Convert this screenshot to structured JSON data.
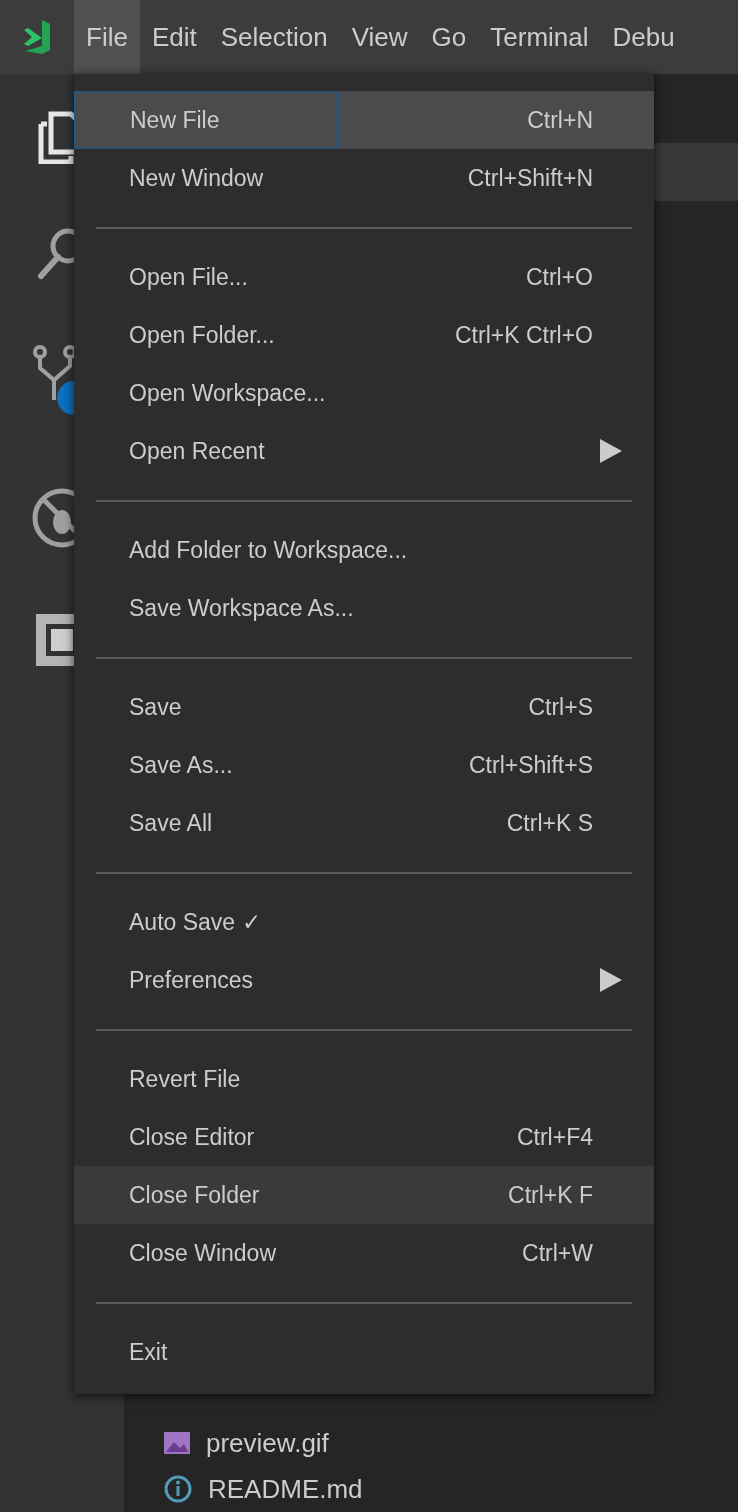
{
  "menu_bar": {
    "items": [
      {
        "label": "File",
        "selected": true
      },
      {
        "label": "Edit",
        "selected": false
      },
      {
        "label": "Selection",
        "selected": false
      },
      {
        "label": "View",
        "selected": false
      },
      {
        "label": "Go",
        "selected": false
      },
      {
        "label": "Terminal",
        "selected": false
      },
      {
        "label": "Debu",
        "selected": false
      }
    ]
  },
  "file_menu": {
    "sections": [
      [
        {
          "label": "New File",
          "shortcut": "Ctrl+N",
          "selected": true,
          "hovered": false,
          "submenu": false
        },
        {
          "label": "New Window",
          "shortcut": "Ctrl+Shift+N",
          "selected": false,
          "hovered": false,
          "submenu": false
        }
      ],
      [
        {
          "label": "Open File...",
          "shortcut": "Ctrl+O",
          "selected": false,
          "hovered": false,
          "submenu": false
        },
        {
          "label": "Open Folder...",
          "shortcut": "Ctrl+K Ctrl+O",
          "selected": false,
          "hovered": false,
          "submenu": false
        },
        {
          "label": "Open Workspace...",
          "selected": false,
          "hovered": false,
          "submenu": false
        },
        {
          "label": "Open Recent",
          "selected": false,
          "hovered": false,
          "submenu": true
        }
      ],
      [
        {
          "label": "Add Folder to Workspace...",
          "selected": false,
          "hovered": false,
          "submenu": false
        },
        {
          "label": "Save Workspace As...",
          "selected": false,
          "hovered": false,
          "submenu": false
        }
      ],
      [
        {
          "label": "Save",
          "shortcut": "Ctrl+S",
          "selected": false,
          "hovered": false,
          "submenu": false
        },
        {
          "label": "Save As...",
          "shortcut": "Ctrl+Shift+S",
          "selected": false,
          "hovered": false,
          "submenu": false
        },
        {
          "label": "Save All",
          "shortcut": "Ctrl+K S",
          "selected": false,
          "hovered": false,
          "submenu": false
        }
      ],
      [
        {
          "label": "Auto Save ✓",
          "selected": false,
          "hovered": false,
          "submenu": false
        },
        {
          "label": "Preferences",
          "selected": false,
          "hovered": false,
          "submenu": true
        }
      ],
      [
        {
          "label": "Revert File",
          "selected": false,
          "hovered": false,
          "submenu": false
        },
        {
          "label": "Close Editor",
          "shortcut": "Ctrl+F4",
          "selected": false,
          "hovered": false,
          "submenu": false
        },
        {
          "label": "Close Folder",
          "shortcut": "Ctrl+K F",
          "selected": false,
          "hovered": true,
          "submenu": false
        },
        {
          "label": "Close Window",
          "shortcut": "Ctrl+W",
          "selected": false,
          "hovered": false,
          "submenu": false
        }
      ],
      [
        {
          "label": "Exit",
          "selected": false,
          "hovered": false,
          "submenu": false
        }
      ]
    ]
  },
  "explorer": {
    "files": [
      {
        "name": "preview.gif",
        "kind": "image"
      },
      {
        "name": "README.md",
        "kind": "info"
      }
    ]
  }
}
